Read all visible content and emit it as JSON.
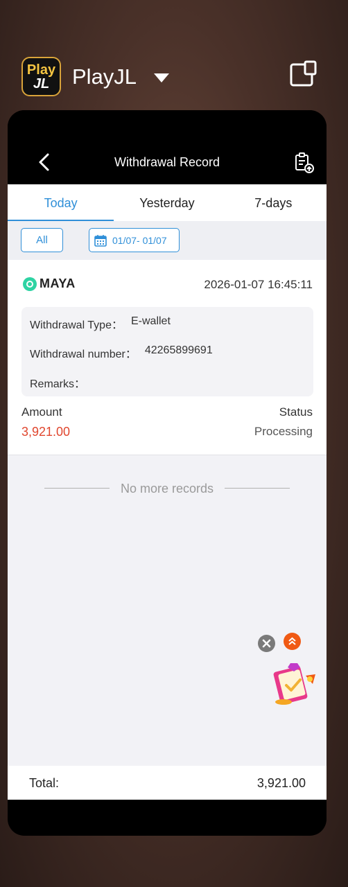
{
  "app": {
    "icon_line1": "Play",
    "icon_line2": "JL",
    "name": "PlayJL"
  },
  "header": {
    "title": "Withdrawal Record"
  },
  "tabs": [
    {
      "label": "Today",
      "active": true
    },
    {
      "label": "Yesterday",
      "active": false
    },
    {
      "label": "7-days",
      "active": false
    }
  ],
  "filters": {
    "all_label": "All",
    "date_range": "01/07- 01/07"
  },
  "record": {
    "method": "MAYA",
    "datetime": "2026-01-07 16:45:11",
    "type_label": "Withdrawal Type：",
    "type_value": "E-wallet",
    "number_label": "Withdrawal number：",
    "number_value": "42265899691",
    "remarks_label": "Remarks：",
    "remarks_value": "",
    "amount_label": "Amount",
    "amount_value": "3,921.00",
    "status_label": "Status",
    "status_value": "Processing"
  },
  "list_end_text": "No more records",
  "footer": {
    "total_label": "Total:",
    "total_value": "3,921.00"
  },
  "colors": {
    "accent": "#2f8fd8",
    "amount": "#e0462e",
    "maya": "#2ed3a3"
  }
}
